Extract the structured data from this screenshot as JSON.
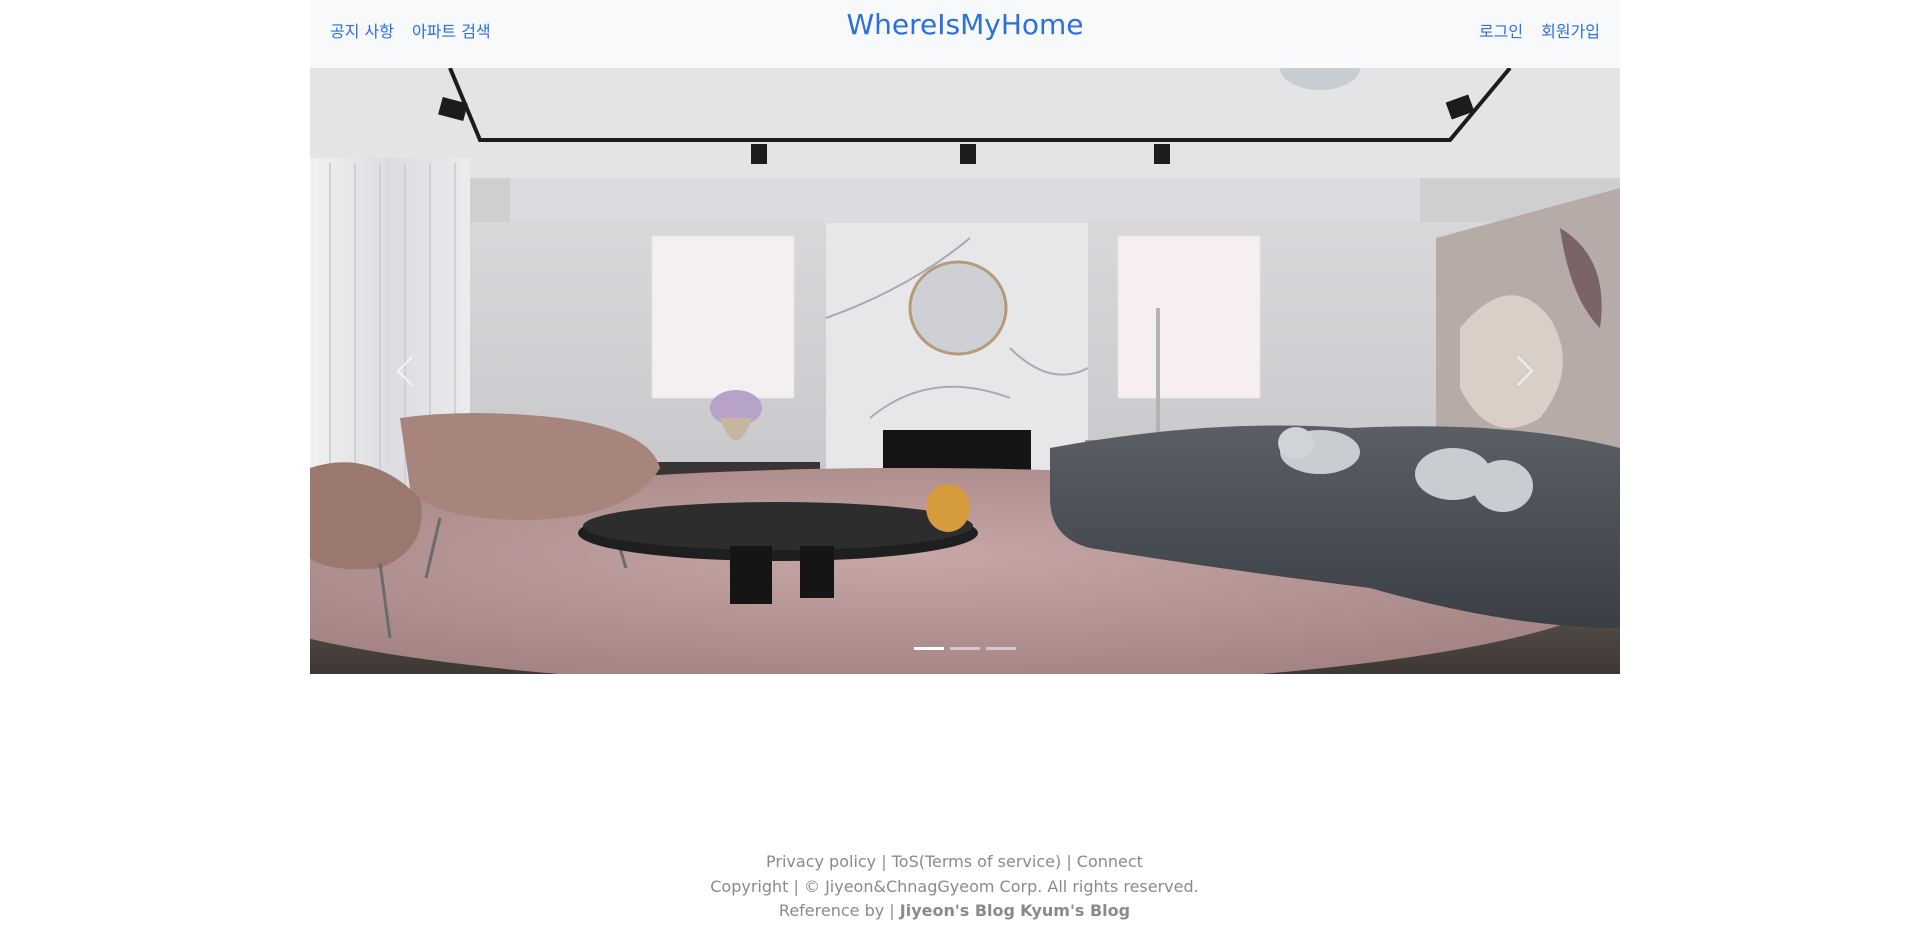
{
  "header": {
    "brand": "WhereIsMyHome",
    "nav_left": [
      {
        "label": "공지 사항"
      },
      {
        "label": "아파트 검색"
      }
    ],
    "nav_right": [
      {
        "label": "로그인"
      },
      {
        "label": "회원가입"
      }
    ]
  },
  "carousel": {
    "slide_count": 3,
    "active_index": 0,
    "controls": {
      "prev_icon": "chevron-left-icon",
      "next_icon": "chevron-right-icon"
    }
  },
  "footer": {
    "links": {
      "privacy": "Privacy policy",
      "sep1": " | ",
      "tos": "ToS(Terms of service)",
      "sep2": " | ",
      "connect": "Connect"
    },
    "copyright": "Copyright | © Jiyeon&ChnagGyeom Corp. All rights reserved.",
    "reference_prefix": "Reference by | ",
    "reference_links": {
      "jiyeon": "Jiyeon's Blog",
      "space": " ",
      "kyum": "Kyum's Blog"
    }
  },
  "colors": {
    "accent": "#2b6fe0",
    "header_bg": "#f8f9fa",
    "footer_text": "#8a8a8a"
  }
}
